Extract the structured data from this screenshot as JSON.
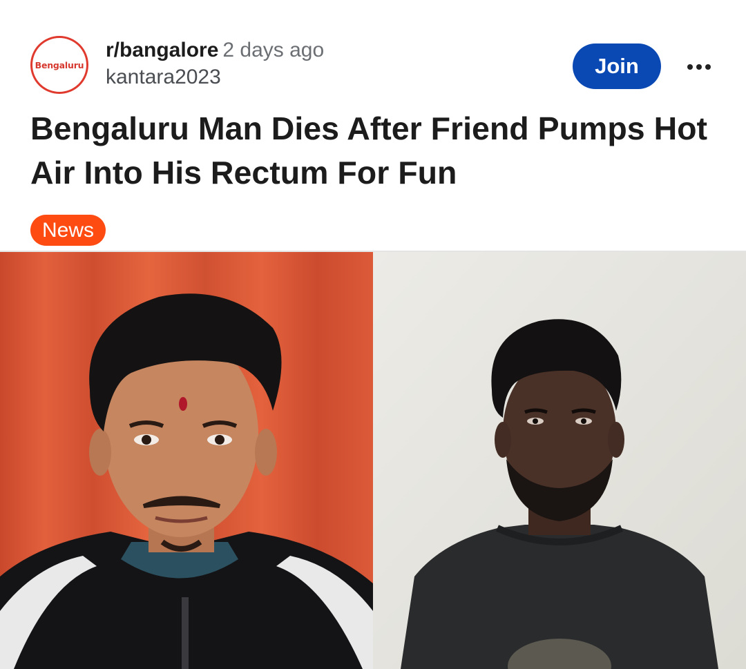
{
  "post": {
    "community_avatar_text": "Bengaluru",
    "subreddit": "r/bangalore",
    "timestamp": "2 days ago",
    "author": "kantara2023",
    "join_label": "Join",
    "more_icon": "more-horizontal-icon",
    "title": "Bengaluru Man Dies After Friend Pumps Hot Air Into His Rectum For Fun",
    "flair": "News"
  },
  "colors": {
    "join_button": "#0a49b4",
    "flair_background": "#fd4b12",
    "avatar_border": "#e03a2e"
  }
}
